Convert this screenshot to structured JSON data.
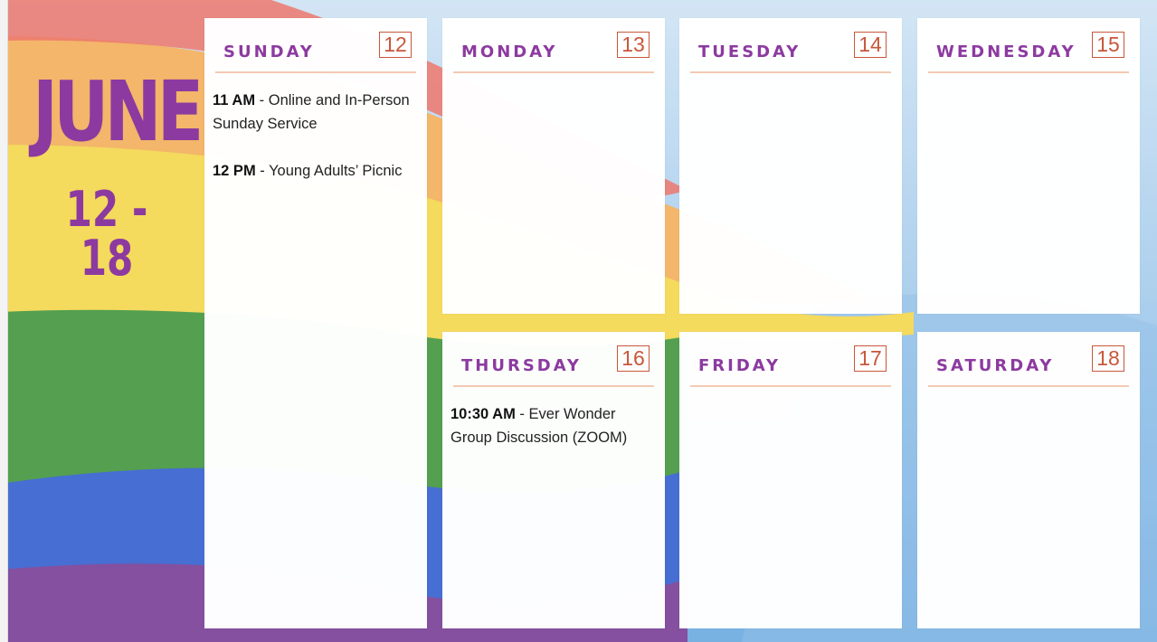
{
  "header": {
    "month": "JUNE",
    "range": "12 - 18"
  },
  "colors": {
    "day_name": "#8c3aa0",
    "date_box": "#c8573a",
    "rule": "#f4c9b3"
  },
  "days": [
    {
      "name": "SUNDAY",
      "date": "12",
      "events": [
        {
          "time": "11 AM",
          "sep": " - ",
          "title": "Online and In-Person Sunday Service"
        },
        {
          "time": "12 PM",
          "sep": " - ",
          "title": "Young Adults’ Picnic"
        }
      ]
    },
    {
      "name": "MONDAY",
      "date": "13",
      "events": []
    },
    {
      "name": "TUESDAY",
      "date": "14",
      "events": []
    },
    {
      "name": "WEDNESDAY",
      "date": "15",
      "events": []
    },
    {
      "name": "THURSDAY",
      "date": "16",
      "events": [
        {
          "time": "10:30 AM",
          "sep": " - ",
          "title": "Ever Wonder Group Discussion (ZOOM)"
        }
      ]
    },
    {
      "name": "FRIDAY",
      "date": "17",
      "events": []
    },
    {
      "name": "SATURDAY",
      "date": "18",
      "events": []
    }
  ]
}
